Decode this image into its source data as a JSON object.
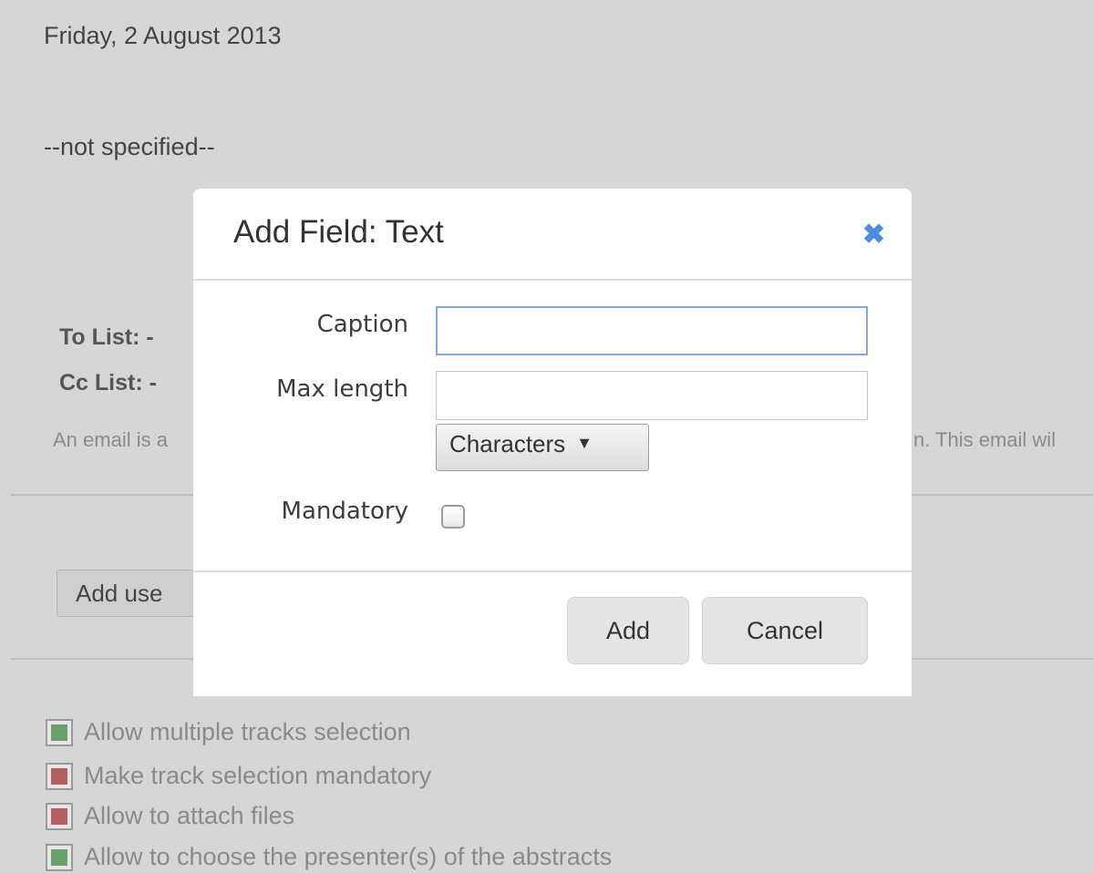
{
  "background": {
    "date": "Friday, 2 August 2013",
    "not_specified": "--not specified--",
    "to_list": "To List: -",
    "cc_list": "Cc List: -",
    "email_note_left": "An email is a",
    "email_note_right": "n. This email wil",
    "add_user_button": "Add use",
    "options": [
      {
        "label": "Allow multiple tracks selection",
        "state": "enabled",
        "color": "#6aa06a"
      },
      {
        "label": "Make track selection mandatory",
        "state": "disabled",
        "color": "#b45f5f"
      },
      {
        "label": "Allow to attach files",
        "state": "disabled",
        "color": "#b45f5f"
      },
      {
        "label": "Allow to choose the presenter(s) of the abstracts",
        "state": "enabled",
        "color": "#6aa06a"
      }
    ]
  },
  "modal": {
    "title": "Add Field: Text",
    "close_icon": "close-x-icon",
    "fields": {
      "caption_label": "Caption",
      "caption_value": "",
      "max_length_label": "Max length",
      "max_length_value": "",
      "unit_select": "Characters",
      "mandatory_label": "Mandatory",
      "mandatory_checked": false
    },
    "buttons": {
      "add": "Add",
      "cancel": "Cancel"
    }
  }
}
